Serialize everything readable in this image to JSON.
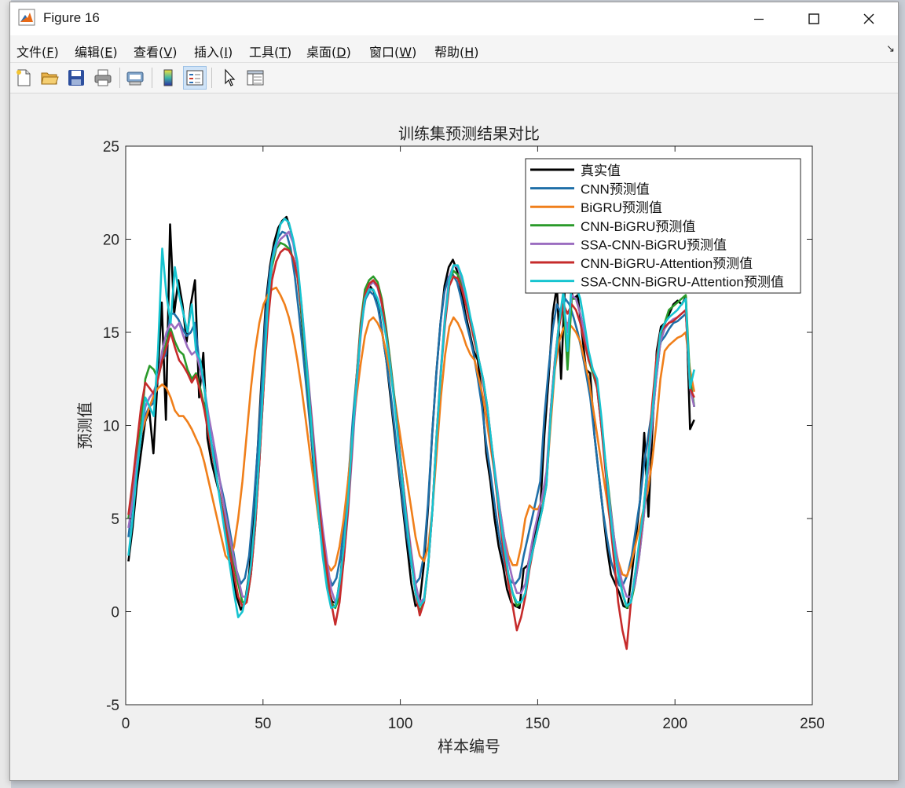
{
  "window": {
    "title": "Figure 16"
  },
  "menu": {
    "items": [
      {
        "text": "文件(",
        "key": "F",
        "end": ")"
      },
      {
        "text": "编辑(",
        "key": "E",
        "end": ")"
      },
      {
        "text": "查看(",
        "key": "V",
        "end": ")"
      },
      {
        "text": "插入(",
        "key": "I",
        "end": ")"
      },
      {
        "text": "工具(",
        "key": "T",
        "end": ")"
      },
      {
        "text": "桌面(",
        "key": "D",
        "end": ")"
      },
      {
        "text": "窗口(",
        "key": "W",
        "end": ")"
      },
      {
        "text": "帮助(",
        "key": "H",
        "end": ")"
      }
    ]
  },
  "toolbar": {
    "icons": [
      "new-figure-icon",
      "open-file-icon",
      "save-icon",
      "print-icon",
      "print-preview-icon",
      "colorbar-icon",
      "legend-icon",
      "pointer-icon",
      "property-inspector-icon"
    ]
  },
  "chart_data": {
    "type": "line",
    "title": "训练集预测结果对比",
    "xlabel": "样本编号",
    "ylabel": "预测值",
    "xlim": [
      0,
      250
    ],
    "ylim": [
      -5,
      25
    ],
    "xticks": [
      0,
      50,
      100,
      150,
      200,
      250
    ],
    "yticks": [
      -5,
      0,
      5,
      10,
      15,
      20,
      25
    ],
    "grid": false,
    "legend_position": "top-right",
    "series": [
      {
        "name": "真实值",
        "color": "#000000",
        "values": [
          2.7,
          4.5,
          6.8,
          8.5,
          10.2,
          10.8,
          8.5,
          12.5,
          16.6,
          10.3,
          20.8,
          16,
          17.8,
          16.5,
          14.5,
          16.5,
          17.8,
          11.5,
          13.9,
          9.3,
          8,
          7.1,
          6.2,
          5,
          3.5,
          2,
          0.8,
          0.1,
          0.5,
          2,
          5,
          8.5,
          12.5,
          16.5,
          18.5,
          19.8,
          20.6,
          21,
          21.2,
          20.5,
          19.5,
          17.5,
          14.8,
          12,
          9.2,
          6.5,
          4.5,
          2.8,
          1.3,
          0.5,
          0.5,
          2,
          4.5,
          7,
          10,
          12.5,
          15.5,
          17,
          17.5,
          17.2,
          16.5,
          15,
          13.5,
          11.5,
          9.5,
          7.5,
          5.5,
          3.5,
          1.5,
          0.3,
          0.5,
          2.5,
          5.5,
          9.5,
          12.8,
          15.5,
          17.5,
          18.5,
          18.9,
          18.3,
          17.2,
          16,
          15,
          14,
          13.5,
          11.5,
          8.5,
          7,
          5,
          3.5,
          2.5,
          1.2,
          0.5,
          0.3,
          0.2,
          2.3,
          2.5,
          3.5,
          4.5,
          5.5,
          9.5,
          12.5,
          16,
          17.5,
          12.5,
          18,
          17.5,
          16.8,
          17,
          15,
          13,
          12.8,
          9.5,
          7.5,
          5.5,
          3.5,
          2,
          1.5,
          1,
          0.3,
          0.2,
          2,
          4,
          6,
          9.6,
          5.1,
          10,
          14,
          15.3,
          15.5,
          16,
          16.5,
          16.7,
          16.5,
          16.9,
          9.8,
          10.3
        ]
      },
      {
        "name": "CNN预测值",
        "color": "#1f6fa8",
        "values": [
          4,
          6,
          8,
          9.5,
          10.5,
          11,
          11.2,
          12.5,
          13.5,
          13.8,
          16,
          16,
          15.7,
          15.2,
          14.8,
          15,
          15.5,
          13.5,
          12.5,
          10.5,
          9,
          8,
          7,
          6,
          4.8,
          3.5,
          2.2,
          1.5,
          1.8,
          3,
          5.5,
          8.5,
          12,
          16,
          18.3,
          19.5,
          20.1,
          20.4,
          20.3,
          19.5,
          18,
          16,
          13.8,
          11.5,
          9.2,
          7,
          5,
          3.3,
          2,
          1.4,
          1.8,
          3,
          5,
          7.5,
          10.5,
          13,
          15.5,
          16.8,
          17.2,
          17,
          16.3,
          15,
          13.5,
          11.8,
          9.8,
          7.7,
          5.8,
          4,
          2.5,
          1.5,
          1.8,
          3,
          5.8,
          9.5,
          12.8,
          15.5,
          17.2,
          18,
          18.1,
          17.7,
          16.8,
          15.7,
          14.8,
          13.8,
          12.5,
          11,
          9,
          7.5,
          5.8,
          4.2,
          3,
          2,
          1.6,
          1.5,
          1.8,
          3,
          4,
          5,
          6,
          7,
          10.5,
          13,
          15.2,
          16.5,
          16,
          16.8,
          16.5,
          15.8,
          15,
          14,
          12.8,
          11.5,
          9.5,
          7.5,
          5.5,
          4,
          2.7,
          2,
          1.4,
          1.5,
          2,
          3,
          4.5,
          6,
          8,
          9.5,
          11,
          13.5,
          14.5,
          14.8,
          15.2,
          15.5,
          15.6,
          15.8,
          16,
          12.5,
          11
        ]
      },
      {
        "name": "BiGRU预测值",
        "color": "#f07f1a",
        "values": [
          5,
          6.5,
          8,
          9.5,
          10.3,
          11,
          11.6,
          12,
          12.2,
          12,
          11.5,
          10.8,
          10.5,
          10.5,
          10.2,
          9.8,
          9.3,
          8.8,
          8,
          7,
          6,
          5,
          4,
          3,
          2.7,
          3.5,
          5,
          7,
          9.5,
          12,
          14,
          15.5,
          16.5,
          17,
          17.3,
          17.4,
          17,
          16.5,
          15.8,
          14.8,
          13.5,
          12,
          10.3,
          8.5,
          6.8,
          5,
          3.7,
          2.6,
          2.2,
          2.5,
          3.5,
          5,
          7,
          9.3,
          11.5,
          13.3,
          14.8,
          15.6,
          15.8,
          15.5,
          15,
          14,
          12.8,
          11.5,
          10,
          8.5,
          7,
          5.5,
          4,
          3,
          2.7,
          3.5,
          5.5,
          8.5,
          11.5,
          13.8,
          15.3,
          15.8,
          15.5,
          15,
          14.3,
          13.8,
          13.5,
          12.5,
          11.5,
          10,
          8.5,
          7,
          5.5,
          4,
          3,
          2.5,
          2.5,
          3.5,
          5,
          5.7,
          5.5,
          5.5,
          6,
          7,
          10,
          13,
          14.5,
          15.2,
          15.5,
          15.3,
          15,
          14.5,
          13.5,
          12.5,
          11,
          9.5,
          8,
          6.5,
          5,
          3.8,
          2.7,
          2,
          1.9,
          2.5,
          3.5,
          4.5,
          5.5,
          6.5,
          8,
          10,
          12.5,
          14,
          14.3,
          14.5,
          14.7,
          14.8,
          15,
          13,
          11.8
        ]
      },
      {
        "name": "CNN-BiGRU预测值",
        "color": "#2a9a2a",
        "values": [
          5,
          6.5,
          8.5,
          10,
          12.5,
          13.2,
          13,
          12.5,
          13.5,
          14.5,
          15.2,
          14.5,
          14,
          13.8,
          13,
          12.5,
          12.8,
          12,
          11,
          9.5,
          8.5,
          7,
          5.8,
          4.8,
          3.8,
          2.5,
          1.5,
          0.5,
          0.5,
          2,
          4.5,
          8,
          12,
          16.5,
          18.5,
          19.5,
          19.8,
          19.7,
          19.5,
          19,
          18,
          16,
          13.5,
          10.8,
          8,
          5.5,
          3.5,
          1.8,
          0.5,
          0.2,
          0.8,
          3,
          5.5,
          9,
          12.5,
          15.5,
          17.3,
          17.8,
          18,
          17.7,
          16.8,
          15.3,
          13.5,
          11.5,
          9.2,
          7,
          4.8,
          2.8,
          1,
          0,
          0.5,
          2.5,
          5.5,
          9.5,
          13,
          15.8,
          17.8,
          18.3,
          18.1,
          17.5,
          16.5,
          15.5,
          14.5,
          13.5,
          12.5,
          11,
          9,
          7,
          5,
          3.3,
          2,
          1,
          0.3,
          0.5,
          1,
          2.5,
          3.5,
          4.5,
          5.5,
          7,
          10.8,
          13.5,
          15.5,
          16.8,
          13,
          16.8,
          16.8,
          16,
          15,
          13.5,
          12.8,
          12,
          10,
          8,
          6,
          4,
          2.3,
          1,
          0.2,
          0.5,
          1.5,
          3,
          5,
          7.5,
          10,
          12.5,
          14.5,
          15.5,
          16.2,
          16.4,
          16.6,
          16.8,
          17,
          12.5,
          11
        ]
      },
      {
        "name": "SSA-CNN-BiGRU预测值",
        "color": "#9b6dc0",
        "values": [
          4.5,
          6,
          8,
          9.5,
          11,
          11.5,
          11.8,
          12.5,
          14,
          15,
          15.5,
          15.2,
          15.5,
          14.8,
          14.2,
          13.8,
          14,
          13,
          12,
          10.5,
          9.3,
          8,
          6.5,
          5.2,
          4,
          2.8,
          1.8,
          0.8,
          0.8,
          2,
          4.5,
          8,
          12,
          16,
          18.8,
          19.6,
          20,
          20.2,
          20.4,
          19.8,
          18.5,
          16.5,
          14,
          11.5,
          9,
          6.5,
          4.5,
          2.8,
          1.2,
          0.5,
          1,
          2.8,
          5.3,
          8.5,
          12,
          14.8,
          16.8,
          17.5,
          17.7,
          17.4,
          16.5,
          15,
          13.3,
          11.3,
          9.2,
          7,
          5,
          3.2,
          1.5,
          0.5,
          0.7,
          2.5,
          5.5,
          9.5,
          13,
          16,
          18,
          18.6,
          18.5,
          17.8,
          16.8,
          15.8,
          14.8,
          13.5,
          12.5,
          11,
          9,
          7.2,
          5.5,
          4,
          2.7,
          1.7,
          1,
          1,
          1.5,
          3,
          4.2,
          5.2,
          6.2,
          7.5,
          10.8,
          13.5,
          15.5,
          16.6,
          15,
          17,
          16.8,
          16,
          15,
          13.5,
          13,
          12,
          10,
          7.8,
          5.8,
          4,
          2.5,
          1.5,
          0.8,
          0.8,
          1.5,
          3,
          5,
          7.5,
          10,
          12.5,
          14.5,
          15.2,
          15.5,
          15.7,
          15.8,
          16,
          16.2,
          12,
          11
        ]
      },
      {
        "name": "CNN-BiGRU-Attention预测值",
        "color": "#c62b2b",
        "values": [
          5.2,
          7,
          9,
          11,
          12.3,
          12,
          11.7,
          12.5,
          13.5,
          14.2,
          15,
          14.2,
          13.5,
          13.2,
          12.8,
          12.3,
          12.7,
          11.8,
          10.8,
          9.5,
          8.3,
          7,
          5.8,
          4.5,
          3.2,
          2,
          0.8,
          0.3,
          0.5,
          2,
          4.5,
          8,
          12,
          15.5,
          17.8,
          18.8,
          19.3,
          19.5,
          19.4,
          19,
          18,
          16.2,
          13.8,
          11.2,
          8.5,
          6,
          4,
          2.2,
          0.5,
          -0.7,
          0.5,
          2.8,
          5.5,
          9,
          12.5,
          15.3,
          17,
          17.6,
          17.8,
          17.5,
          16.6,
          15,
          13.3,
          11.3,
          9.2,
          7,
          4.8,
          2.8,
          1,
          -0.2,
          0.5,
          2.5,
          5.5,
          9.5,
          12.8,
          15.5,
          17.5,
          18,
          17.9,
          17.3,
          16.4,
          15.5,
          14.5,
          13.5,
          12.3,
          10.8,
          8.8,
          6.8,
          4.8,
          3,
          1.5,
          0.3,
          -1,
          -0.3,
          0.8,
          2.3,
          3.5,
          4.5,
          5.5,
          6.8,
          10.5,
          13.2,
          15.3,
          16.5,
          16,
          16.5,
          16.2,
          15.5,
          14.5,
          13.5,
          13,
          12,
          10,
          7.5,
          5,
          2.8,
          0.5,
          -1,
          -2,
          0.5,
          2,
          3.5,
          5.5,
          8,
          11,
          13.5,
          15,
          15.3,
          15.5,
          15.6,
          15.8,
          16,
          16.2,
          12,
          11.5
        ]
      },
      {
        "name": "SSA-CNN-BiGRU-Attention预测值",
        "color": "#16c4d0",
        "values": [
          3,
          5,
          7.5,
          9.5,
          11.5,
          11,
          10.5,
          14,
          19.5,
          17,
          15.5,
          18.5,
          17,
          16,
          15,
          16.5,
          14,
          13.5,
          12,
          10,
          8.5,
          7,
          5.5,
          4,
          2.5,
          1,
          -0.3,
          0,
          1,
          2.5,
          5,
          8.5,
          12.5,
          16.5,
          18.8,
          19.8,
          20.8,
          21.1,
          20.9,
          20,
          18.8,
          16.5,
          13.8,
          11,
          8,
          5.3,
          3,
          1.3,
          0.2,
          0.3,
          1.5,
          3.5,
          6,
          9.2,
          12.3,
          15,
          16.8,
          17.3,
          17.3,
          16.8,
          16,
          14.8,
          13.2,
          11.2,
          9,
          6.8,
          4.6,
          2.7,
          1,
          0.3,
          0.6,
          2.5,
          5.5,
          9.5,
          12.8,
          15.8,
          17.8,
          18.6,
          18.6,
          18,
          17,
          15.8,
          14.8,
          13.5,
          12.5,
          11,
          9,
          7,
          5.2,
          3.5,
          2,
          1,
          0.5,
          0.5,
          1,
          2.5,
          3.5,
          4.5,
          5.5,
          6.8,
          10.5,
          13.2,
          15.5,
          17.2,
          14,
          17.8,
          17.5,
          16.8,
          15.5,
          14,
          13,
          12.5,
          10.5,
          8,
          5.5,
          3.5,
          2,
          1,
          0.3,
          0.5,
          2,
          3.8,
          5.5,
          8,
          10.5,
          13,
          15,
          15.5,
          15.8,
          16,
          16.2,
          16.5,
          16.8,
          12,
          13
        ]
      }
    ]
  }
}
